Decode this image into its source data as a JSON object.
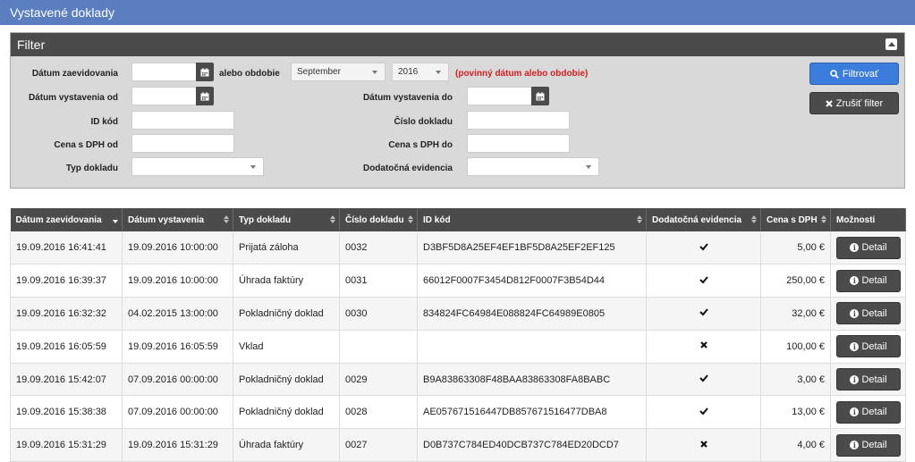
{
  "page": {
    "title": "Vystavené doklady"
  },
  "filter": {
    "title": "Filter",
    "date_recorded_label": "Dátum zaevidovania",
    "or_period_label": "alebo obdobie",
    "month_value": "September",
    "year_value": "2016",
    "required_note": "(povinný dátum alebo obdobie)",
    "issue_from_label": "Dátum vystavenia od",
    "issue_to_label": "Dátum vystavenia do",
    "id_code_label": "ID kód",
    "doc_number_label": "Číslo dokladu",
    "price_from_label": "Cena s DPH od",
    "price_to_label": "Cena s DPH do",
    "doc_type_label": "Typ dokladu",
    "additional_label": "Dodatočná evidencia",
    "date_recorded_value": "",
    "issue_from_value": "",
    "issue_to_value": "",
    "id_code_value": "",
    "doc_number_value": "",
    "price_from_value": "",
    "price_to_value": "",
    "doc_type_value": "",
    "additional_value": "",
    "filter_button": "Filtrovať",
    "cancel_button": "Zrušiť filter"
  },
  "table": {
    "columns": [
      "Dátum zaevidovania",
      "Dátum vystavenia",
      "Typ dokladu",
      "Číslo dokladu",
      "ID kód",
      "Dodatočná evidencia",
      "Cena s DPH",
      "Možnosti"
    ],
    "detail_label": "Detail",
    "rows": [
      {
        "recorded": "19.09.2016 16:41:41",
        "issued": "19.09.2016 10:00:00",
        "type": "Prijatá záloha",
        "number": "0032",
        "id": "D3BF5D8A25EF4EF1BF5D8A25EF2EF125",
        "additional": "check",
        "price": "5,00 €"
      },
      {
        "recorded": "19.09.2016 16:39:37",
        "issued": "19.09.2016 10:00:00",
        "type": "Úhrada faktúry",
        "number": "0031",
        "id": "66012F0007F3454D812F0007F3B54D44",
        "additional": "check",
        "price": "250,00 €"
      },
      {
        "recorded": "19.09.2016 16:32:32",
        "issued": "04.02.2015 13:00:00",
        "type": "Pokladničný doklad",
        "number": "0030",
        "id": "834824FC64984E088824FC64989E0805",
        "additional": "check",
        "price": "32,00 €"
      },
      {
        "recorded": "19.09.2016 16:05:59",
        "issued": "19.09.2016 16:05:59",
        "type": "Vklad",
        "number": "",
        "id": "",
        "additional": "cross",
        "price": "100,00 €"
      },
      {
        "recorded": "19.09.2016 15:42:07",
        "issued": "07.09.2016 00:00:00",
        "type": "Pokladničný doklad",
        "number": "0029",
        "id": "B9A83863308F48BAA83863308FA8BABC",
        "additional": "check",
        "price": "3,00 €"
      },
      {
        "recorded": "19.09.2016 15:38:38",
        "issued": "07.09.2016 00:00:00",
        "type": "Pokladničný doklad",
        "number": "0028",
        "id": "AE057671516447DB857671516477DBA8",
        "additional": "check",
        "price": "13,00 €"
      },
      {
        "recorded": "19.09.2016 15:31:29",
        "issued": "19.09.2016 15:31:29",
        "type": "Úhrada faktúry",
        "number": "0027",
        "id": "D0B737C784ED40DCB737C784ED20DCD7",
        "additional": "cross",
        "price": "4,00 €"
      }
    ]
  }
}
